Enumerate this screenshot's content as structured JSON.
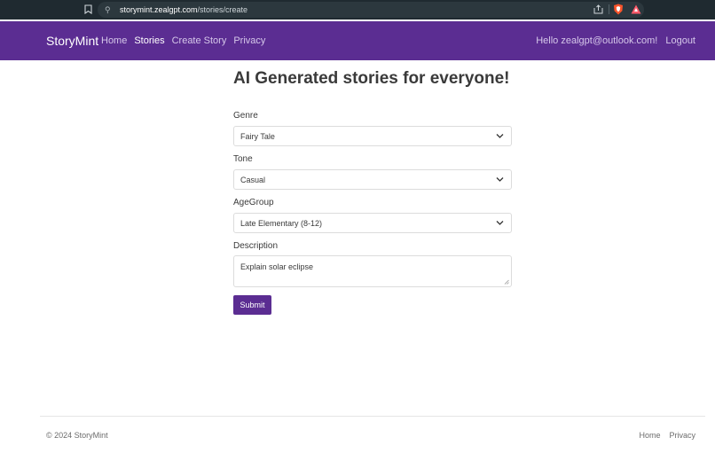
{
  "browser": {
    "url_host": "storymint.zealgpt.com",
    "url_path": "/stories/create"
  },
  "nav": {
    "brand": "StoryMint",
    "links": [
      {
        "label": "Home"
      },
      {
        "label": "Stories",
        "active": true
      },
      {
        "label": "Create Story"
      },
      {
        "label": "Privacy"
      }
    ],
    "greeting": "Hello zealgpt@outlook.com!",
    "logout": "Logout"
  },
  "main": {
    "title": "AI Generated stories for everyone!",
    "genre": {
      "label": "Genre",
      "value": "Fairy Tale"
    },
    "tone": {
      "label": "Tone",
      "value": "Casual"
    },
    "age_group": {
      "label": "AgeGroup",
      "value": "Late Elementary (8-12)"
    },
    "description": {
      "label": "Description",
      "value": "Explain solar eclipse"
    },
    "submit_label": "Submit"
  },
  "footer": {
    "copyright": "© 2024 StoryMint",
    "links": [
      {
        "label": "Home"
      },
      {
        "label": "Privacy"
      }
    ]
  },
  "colors": {
    "brand_purple": "#5b2d92",
    "chrome_bg": "#1f2a30"
  }
}
